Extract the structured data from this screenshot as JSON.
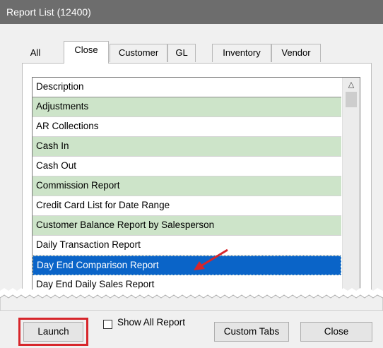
{
  "window": {
    "title": "Report List (12400)"
  },
  "tabs": [
    {
      "label": "All"
    },
    {
      "label": "Close"
    },
    {
      "label": "Customer"
    },
    {
      "label": "GL"
    },
    {
      "label": "Inventory"
    },
    {
      "label": "Vendor"
    }
  ],
  "active_tab": "Close",
  "list": {
    "header": "Description",
    "rows": [
      {
        "label": "Adjustments"
      },
      {
        "label": "AR Collections"
      },
      {
        "label": "Cash In"
      },
      {
        "label": "Cash Out"
      },
      {
        "label": "Commission Report"
      },
      {
        "label": "Credit Card List for Date Range"
      },
      {
        "label": "Customer Balance Report by Salesperson"
      },
      {
        "label": "Daily Transaction Report"
      },
      {
        "label": "Day End Comparison Report"
      },
      {
        "label": "Day End Daily Sales Report"
      }
    ],
    "selected": "Day End Comparison Report"
  },
  "buttons": {
    "launch": "Launch",
    "custom_tabs": "Custom Tabs",
    "close": "Close"
  },
  "checkbox": {
    "label": "Show All Report",
    "checked": false
  },
  "colors": {
    "titlebar": "#6d6d6d",
    "row_alt": "#cde4c9",
    "selected_row": "#0a64c8",
    "annotation_red": "#d7262b"
  }
}
